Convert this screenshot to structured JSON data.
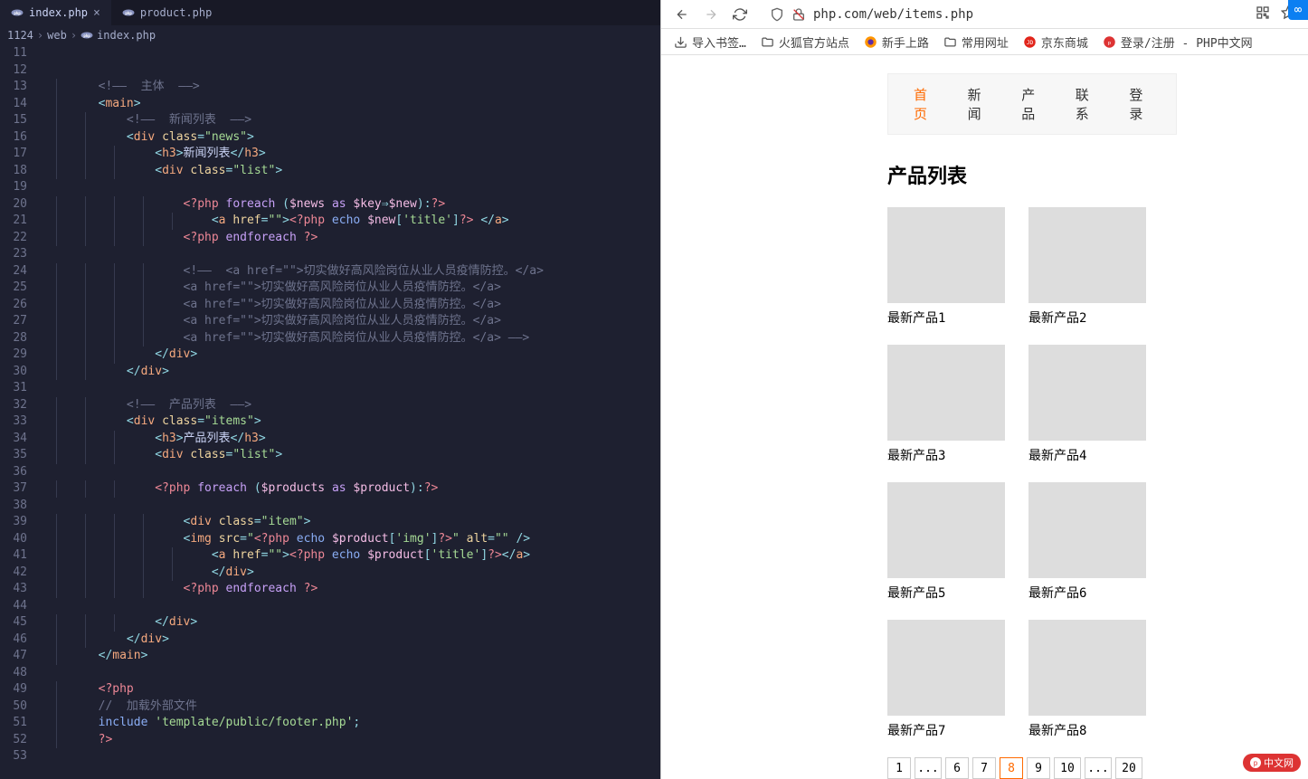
{
  "editor": {
    "tabs": [
      {
        "file": "index.php",
        "active": true,
        "closeable": true
      },
      {
        "file": "product.php",
        "active": false,
        "closeable": false
      }
    ],
    "breadcrumb": {
      "root": "1124",
      "folder": "web",
      "file": "index.php"
    },
    "line_start": 11,
    "line_end": 53,
    "code_lines": [
      {
        "n": 11,
        "indent": 0,
        "html": ""
      },
      {
        "n": 12,
        "indent": 0,
        "html": ""
      },
      {
        "n": 13,
        "indent": 1,
        "html": "<span class='c-cm'>&lt;!——  主体  ——&gt;</span>"
      },
      {
        "n": 14,
        "indent": 1,
        "html": "<span class='c-pun'>&lt;</span><span class='c-tag'>main</span><span class='c-pun'>&gt;</span>"
      },
      {
        "n": 15,
        "indent": 2,
        "html": "<span class='c-cm'>&lt;!——  新闻列表  ——&gt;</span>"
      },
      {
        "n": 16,
        "indent": 2,
        "html": "<span class='c-pun'>&lt;</span><span class='c-tag'>div</span> <span class='c-attr'>class</span><span class='c-pun'>=</span><span class='c-str'>\"news\"</span><span class='c-pun'>&gt;</span>"
      },
      {
        "n": 17,
        "indent": 3,
        "html": "<span class='c-pun'>&lt;</span><span class='c-tag'>h3</span><span class='c-pun'>&gt;</span><span class='c-txt'>新闻列表</span><span class='c-pun'>&lt;/</span><span class='c-tag'>h3</span><span class='c-pun'>&gt;</span>"
      },
      {
        "n": 18,
        "indent": 3,
        "html": "<span class='c-pun'>&lt;</span><span class='c-tag'>div</span> <span class='c-attr'>class</span><span class='c-pun'>=</span><span class='c-str'>\"list\"</span><span class='c-pun'>&gt;</span>"
      },
      {
        "n": 19,
        "indent": 0,
        "html": ""
      },
      {
        "n": 20,
        "indent": 4,
        "html": "<span class='c-php'>&lt;?php</span> <span class='c-kw'>foreach</span> <span class='c-pun'>(</span><span class='c-var'>$news</span> <span class='c-kw'>as</span> <span class='c-var'>$key</span><span class='c-pun'>⇒</span><span class='c-var'>$new</span><span class='c-pun'>)</span><span class='c-pun'>:</span><span class='c-php'>?&gt;</span>"
      },
      {
        "n": 21,
        "indent": 5,
        "html": "<span class='c-pun'>&lt;</span><span class='c-tag'>a</span> <span class='c-attr'>href</span><span class='c-pun'>=</span><span class='c-str'>\"\"</span><span class='c-pun'>&gt;</span><span class='c-php'>&lt;?php</span> <span class='c-fn'>echo</span> <span class='c-var'>$new</span><span class='c-pun'>[</span><span class='c-str'>'title'</span><span class='c-pun'>]</span><span class='c-php'>?&gt;</span> <span class='c-pun'>&lt;/</span><span class='c-tag'>a</span><span class='c-pun'>&gt;</span>"
      },
      {
        "n": 22,
        "indent": 4,
        "html": "<span class='c-php'>&lt;?php</span> <span class='c-kw'>endforeach</span> <span class='c-php'>?&gt;</span>"
      },
      {
        "n": 23,
        "indent": 0,
        "html": ""
      },
      {
        "n": 24,
        "indent": 4,
        "html": "<span class='c-cm'>&lt;!——  &lt;a href=\"\"&gt;切实做好高风险岗位从业人员疫情防控。&lt;/a&gt;</span>"
      },
      {
        "n": 25,
        "indent": 4,
        "html": "<span class='c-cm'>&lt;a href=\"\"&gt;切实做好高风险岗位从业人员疫情防控。&lt;/a&gt;</span>"
      },
      {
        "n": 26,
        "indent": 4,
        "html": "<span class='c-cm'>&lt;a href=\"\"&gt;切实做好高风险岗位从业人员疫情防控。&lt;/a&gt;</span>"
      },
      {
        "n": 27,
        "indent": 4,
        "html": "<span class='c-cm'>&lt;a href=\"\"&gt;切实做好高风险岗位从业人员疫情防控。&lt;/a&gt;</span>"
      },
      {
        "n": 28,
        "indent": 4,
        "html": "<span class='c-cm'>&lt;a href=\"\"&gt;切实做好高风险岗位从业人员疫情防控。&lt;/a&gt; ——&gt;</span>"
      },
      {
        "n": 29,
        "indent": 3,
        "html": "<span class='c-pun'>&lt;/</span><span class='c-tag'>div</span><span class='c-pun'>&gt;</span>"
      },
      {
        "n": 30,
        "indent": 2,
        "html": "<span class='c-pun'>&lt;/</span><span class='c-tag'>div</span><span class='c-pun'>&gt;</span>"
      },
      {
        "n": 31,
        "indent": 0,
        "html": ""
      },
      {
        "n": 32,
        "indent": 2,
        "html": "<span class='c-cm'>&lt;!——  产品列表  ——&gt;</span>"
      },
      {
        "n": 33,
        "indent": 2,
        "html": "<span class='c-pun'>&lt;</span><span class='c-tag'>div</span> <span class='c-attr'>class</span><span class='c-pun'>=</span><span class='c-str'>\"items\"</span><span class='c-pun'>&gt;</span>"
      },
      {
        "n": 34,
        "indent": 3,
        "html": "<span class='c-pun'>&lt;</span><span class='c-tag'>h3</span><span class='c-pun'>&gt;</span><span class='c-txt'>产品列表</span><span class='c-pun'>&lt;/</span><span class='c-tag'>h3</span><span class='c-pun'>&gt;</span>"
      },
      {
        "n": 35,
        "indent": 3,
        "html": "<span class='c-pun'>&lt;</span><span class='c-tag'>div</span> <span class='c-attr'>class</span><span class='c-pun'>=</span><span class='c-str'>\"list\"</span><span class='c-pun'>&gt;</span>"
      },
      {
        "n": 36,
        "indent": 0,
        "html": ""
      },
      {
        "n": 37,
        "indent": 3,
        "html": "<span class='c-php'>&lt;?php</span> <span class='c-kw'>foreach</span> <span class='c-pun'>(</span><span class='c-var'>$products</span> <span class='c-kw'>as</span> <span class='c-var'>$product</span><span class='c-pun'>)</span><span class='c-pun'>:</span><span class='c-php'>?&gt;</span>"
      },
      {
        "n": 38,
        "indent": 0,
        "html": ""
      },
      {
        "n": 39,
        "indent": 4,
        "html": "<span class='c-pun'>&lt;</span><span class='c-tag'>div</span> <span class='c-attr'>class</span><span class='c-pun'>=</span><span class='c-str'>\"item\"</span><span class='c-pun'>&gt;</span>"
      },
      {
        "n": 40,
        "indent": 4,
        "html": "<span class='c-pun'>&lt;</span><span class='c-tag'>img</span> <span class='c-attr'>src</span><span class='c-pun'>=</span><span class='c-str'>\"</span><span class='c-php'>&lt;?php</span> <span class='c-fn'>echo</span> <span class='c-var'>$product</span><span class='c-pun'>[</span><span class='c-str'>'img'</span><span class='c-pun'>]</span><span class='c-php'>?&gt;</span><span class='c-str'>\"</span> <span class='c-attr'>alt</span><span class='c-pun'>=</span><span class='c-str'>\"\"</span> <span class='c-pun'>/&gt;</span>"
      },
      {
        "n": 41,
        "indent": 5,
        "html": "<span class='c-pun'>&lt;</span><span class='c-tag'>a</span> <span class='c-attr'>href</span><span class='c-pun'>=</span><span class='c-str'>\"\"</span><span class='c-pun'>&gt;</span><span class='c-php'>&lt;?php</span> <span class='c-fn'>echo</span> <span class='c-var'>$product</span><span class='c-pun'>[</span><span class='c-str'>'title'</span><span class='c-pun'>]</span><span class='c-php'>?&gt;</span><span class='c-pun'>&lt;/</span><span class='c-tag'>a</span><span class='c-pun'>&gt;</span>"
      },
      {
        "n": 42,
        "indent": 5,
        "html": "<span class='c-pun'>&lt;/</span><span class='c-tag'>div</span><span class='c-pun'>&gt;</span>"
      },
      {
        "n": 43,
        "indent": 4,
        "html": "<span class='c-php'>&lt;?php</span> <span class='c-kw'>endforeach</span> <span class='c-php'>?&gt;</span>"
      },
      {
        "n": 44,
        "indent": 0,
        "html": ""
      },
      {
        "n": 45,
        "indent": 3,
        "html": "<span class='c-pun'>&lt;/</span><span class='c-tag'>div</span><span class='c-pun'>&gt;</span>"
      },
      {
        "n": 46,
        "indent": 2,
        "html": "<span class='c-pun'>&lt;/</span><span class='c-tag'>div</span><span class='c-pun'>&gt;</span>"
      },
      {
        "n": 47,
        "indent": 1,
        "html": "<span class='c-pun'>&lt;/</span><span class='c-tag'>main</span><span class='c-pun'>&gt;</span>"
      },
      {
        "n": 48,
        "indent": 0,
        "html": ""
      },
      {
        "n": 49,
        "indent": 1,
        "html": "<span class='c-php'>&lt;?php</span>"
      },
      {
        "n": 50,
        "indent": 1,
        "html": "<span class='c-cm'>//  加载外部文件</span>"
      },
      {
        "n": 51,
        "indent": 1,
        "html": "<span class='c-fn'>include</span> <span class='c-str'>'template/public/footer.php'</span><span class='c-pun'>;</span>"
      },
      {
        "n": 52,
        "indent": 1,
        "html": "<span class='c-php'>?&gt;</span>"
      },
      {
        "n": 53,
        "indent": 0,
        "html": ""
      }
    ]
  },
  "browser": {
    "url": "php.com/web/items.php",
    "bookmarks": [
      {
        "icon": "import",
        "label": "导入书签…"
      },
      {
        "icon": "folder",
        "label": "火狐官方站点"
      },
      {
        "icon": "firefox",
        "label": "新手上路"
      },
      {
        "icon": "folder",
        "label": "常用网址"
      },
      {
        "icon": "jd",
        "label": "京东商城"
      },
      {
        "icon": "phpcn",
        "label": "登录/注册 - PHP中文网"
      }
    ],
    "nav": [
      {
        "label": "首页",
        "active": true
      },
      {
        "label": "新闻",
        "active": false
      },
      {
        "label": "产品",
        "active": false
      },
      {
        "label": "联系",
        "active": false
      },
      {
        "label": "登录",
        "active": false
      }
    ],
    "heading": "产品列表",
    "products": [
      {
        "label": "最新产品1",
        "thumb": "th1"
      },
      {
        "label": "最新产品2",
        "thumb": "th2"
      },
      {
        "label": "最新产品3",
        "thumb": "th3"
      },
      {
        "label": "最新产品4",
        "thumb": "th4"
      },
      {
        "label": "最新产品5",
        "thumb": "th5"
      },
      {
        "label": "最新产品6",
        "thumb": "th6"
      },
      {
        "label": "最新产品7",
        "thumb": "th7"
      },
      {
        "label": "最新产品8",
        "thumb": "th8"
      }
    ],
    "pagination": [
      "1",
      "...",
      "6",
      "7",
      "8",
      "9",
      "10",
      "...",
      "20"
    ],
    "pagination_current": "8",
    "watermark": "中文网"
  }
}
